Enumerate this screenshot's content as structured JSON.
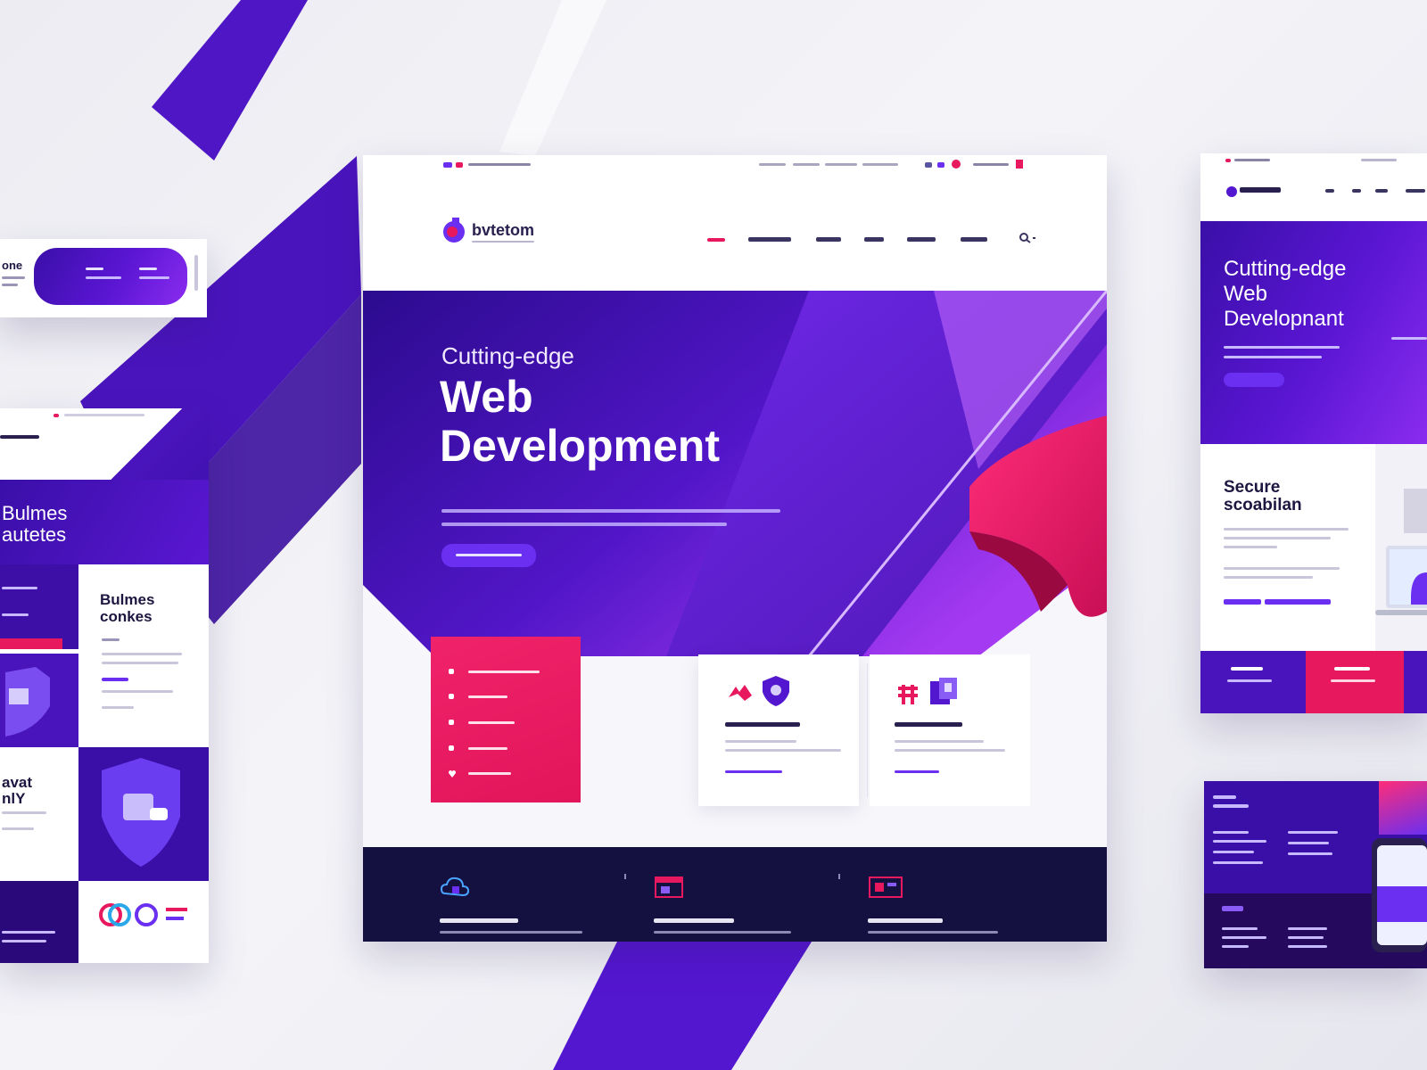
{
  "colors": {
    "purple_dark": "#2a0a7a",
    "purple": "#5417d0",
    "purple_light": "#8a2cf0",
    "pink": "#e8185e",
    "navy": "#14103f",
    "white": "#ffffff"
  },
  "main": {
    "brand": "bvtetom",
    "hero_line1": "Cutting-edge",
    "hero_line2": "Web",
    "hero_line3": "Development"
  },
  "right_mockup": {
    "hero_line1": "Cutting-edge",
    "hero_line2": "Web",
    "hero_line3": "Developnant",
    "feature_title_line1": "Secure",
    "feature_title_line2": "scoabilan"
  },
  "left_mockup": {
    "title_line1": "Bulmes",
    "title_line2": "autetes",
    "card_title_line1": "Bulmes",
    "card_title_line2": "conkes",
    "bottom_title_line1": "avat",
    "bottom_title_line2": "nlY"
  },
  "left_banner": {
    "label": "one"
  },
  "icons": {
    "logo": "logo-mark-icon",
    "search": "search-icon",
    "shield": "shield-icon",
    "cloud": "cloud-icon",
    "browser": "browser-icon",
    "code": "code-icon",
    "heart": "heart-icon",
    "laptop": "laptop-icon",
    "phone": "phone-icon"
  }
}
